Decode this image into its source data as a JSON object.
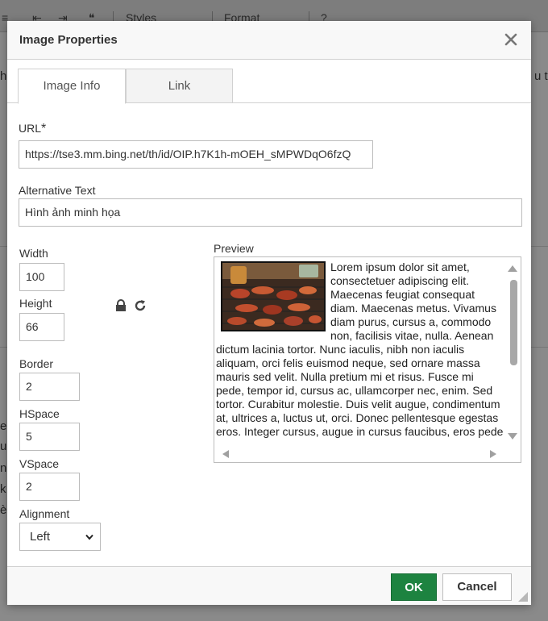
{
  "dialog": {
    "title": "Image Properties",
    "close_symbol": "✕",
    "tabs": [
      {
        "label": "Image Info",
        "active": true
      },
      {
        "label": "Link",
        "active": false
      }
    ]
  },
  "form": {
    "url_label": "URL",
    "url_required_mark": "*",
    "url_value": "https://tse3.mm.bing.net/th/id/OIP.h7K1h-mOEH_sMPWDqO6fzQ",
    "alt_label": "Alternative Text",
    "alt_value": "Hình ảnh minh họa",
    "width_label": "Width",
    "width_value": "100",
    "height_label": "Height",
    "height_value": "66",
    "border_label": "Border",
    "border_value": "2",
    "hspace_label": "HSpace",
    "hspace_value": "5",
    "vspace_label": "VSpace",
    "vspace_value": "2",
    "alignment_label": "Alignment",
    "alignment_value": "Left",
    "lock_icon": "lock-icon",
    "reset_icon": "reset-size-icon"
  },
  "preview": {
    "label": "Preview",
    "text": "Lorem ipsum dolor sit amet, consectetuer adipiscing elit. Maecenas feugiat consequat diam. Maecenas metus. Vivamus diam purus, cursus a, commodo non, facilisis vitae, nulla. Aenean dictum lacinia tortor. Nunc iaculis, nibh non iaculis aliquam, orci felis euismod neque, sed ornare massa mauris sed velit. Nulla pretium mi et risus. Fusce mi pede, tempor id, cursus ac, ullamcorper nec, enim. Sed tortor. Curabitur molestie. Duis velit augue, condimentum at, ultrices a, luctus ut, orci. Donec pellentesque egestas eros. Integer cursus, augue in cursus faucibus, eros pede"
  },
  "footer": {
    "ok_label": "OK",
    "cancel_label": "Cancel"
  },
  "background": {
    "toolbar_styles": "Styles",
    "toolbar_format": "Format"
  },
  "colors": {
    "ok_green": "#1d8340",
    "dialog_bg": "#ffffff",
    "header_bg": "#f8f8f8"
  }
}
